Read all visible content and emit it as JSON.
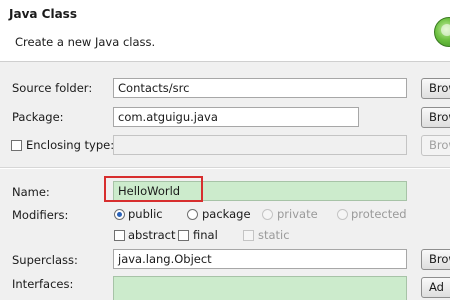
{
  "header": {
    "title": "Java Class",
    "subtitle": "Create a new Java class."
  },
  "form": {
    "source_folder": {
      "label": "Source folder:",
      "value": "Contacts/src",
      "button": "Brow"
    },
    "package": {
      "label": "Package:",
      "value": "com.atguigu.java",
      "button": "Brow"
    },
    "enclosing_type": {
      "label": "Enclosing type:",
      "value": "",
      "button": "Brow",
      "checked": false
    },
    "name": {
      "label": "Name:",
      "value": "HelloWorld"
    },
    "modifiers": {
      "label": "Modifiers:",
      "access": [
        "public",
        "package",
        "private",
        "protected"
      ],
      "selected": "public",
      "flags": [
        "abstract",
        "final",
        "static"
      ]
    },
    "superclass": {
      "label": "Superclass:",
      "value": "java.lang.Object",
      "button": "Brow"
    },
    "interfaces": {
      "label": "Interfaces:",
      "button": "Ad"
    }
  }
}
